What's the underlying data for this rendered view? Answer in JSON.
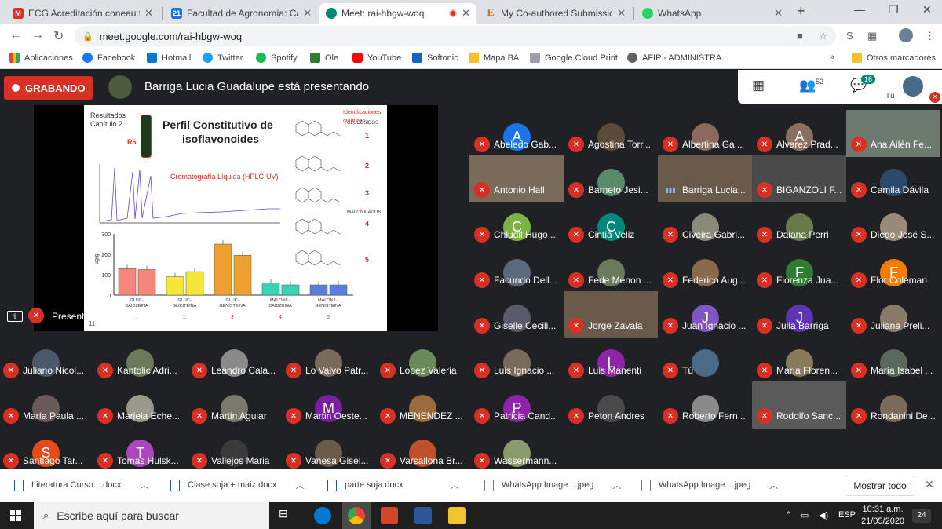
{
  "browser": {
    "tabs": [
      {
        "title": "ECG Acreditación coneau fich",
        "active": false,
        "fav_color": "#d93025"
      },
      {
        "title": "Facultad de Agronomía: Calen",
        "active": false,
        "fav_color": "#1a73e8"
      },
      {
        "title": "Meet: rai-hbgw-woq",
        "active": true,
        "fav_color": "#00897b"
      },
      {
        "title": "My Co-authored Submission",
        "active": false,
        "fav_color": "#e8710a"
      },
      {
        "title": "WhatsApp",
        "active": false,
        "fav_color": "#25d366"
      }
    ],
    "new_tab_label": "+",
    "url": "meet.google.com/rai-hbgw-woq",
    "bookmarks": [
      {
        "label": "Aplicaciones",
        "color": "#ea4335"
      },
      {
        "label": "Facebook",
        "color": "#1877f2"
      },
      {
        "label": "Hotmail",
        "color": "#0078d4"
      },
      {
        "label": "Twitter",
        "color": "#1da1f2"
      },
      {
        "label": "Spotify",
        "color": "#1db954"
      },
      {
        "label": "Ole",
        "color": "#2e7d32"
      },
      {
        "label": "YouTube",
        "color": "#ff0000"
      },
      {
        "label": "Softonic",
        "color": "#1565c0"
      },
      {
        "label": "Mapa BA",
        "color": "#fbc02d"
      },
      {
        "label": "Google Cloud Print",
        "color": "#5f6368"
      },
      {
        "label": "AFIP - ADMINISTRA...",
        "color": "#5f6368"
      }
    ],
    "other_bookmarks_label": "Otros marcadores"
  },
  "meet": {
    "recording_label": "GRABANDO",
    "presenting_text": "Barriga Lucia Guadalupe está presentando",
    "participants_count": "52",
    "chat_count": "16",
    "self_label": "Tú",
    "presentation_label": "Presentación (Barriga Lucia Guadalupe)",
    "slide": {
      "section_line1": "Resultados",
      "section_line2": "Capítulo 2",
      "stage": "R6",
      "title_line1": "Perfil Constitutivo de",
      "title_line2": "isoflavonoides",
      "chromatography": "Cromatografía Líquida (HPLC-UV)",
      "identifications": "Identificaciones químicas",
      "glucosides": "GLUCOSIDOS",
      "malonylated": "MALONILADOS",
      "compound_numbers": [
        "1",
        "2",
        "3",
        "4",
        "5"
      ],
      "y_axis_label": "µg/g",
      "y_ticks": [
        "300",
        "200",
        "100",
        "0"
      ],
      "page_number": "11"
    },
    "chart_data": {
      "type": "bar",
      "categories": [
        "GLUC-DAIDZEINA",
        "GLUC-GLICITEINA",
        "GLUC-GENISTEINA",
        "MALONIL-DAIDZEINA",
        "MALONIL-GENISTEINA"
      ],
      "category_numbers": [
        "1",
        "2",
        "3",
        "4",
        "5"
      ],
      "ylabel": "µg/g",
      "ylim": [
        0,
        300
      ],
      "series": [
        {
          "color": "#f4877a",
          "values": [
            130,
            90,
            250,
            60,
            50
          ]
        },
        {
          "color_list": [
            "#f4877a",
            "#f7e63a",
            "#f0a030",
            "#3ad2b0",
            "#5a7ee0"
          ],
          "values": [
            125,
            115,
            195,
            50,
            50
          ]
        }
      ]
    },
    "participants": [
      {
        "name": "Abeledo Gab...",
        "initial": "A",
        "color": "#1a73e8"
      },
      {
        "name": "Agostina Torr...",
        "initial": "",
        "color": "#5a4a3a"
      },
      {
        "name": "Albertina Ga...",
        "initial": "",
        "color": "#8a6a5a"
      },
      {
        "name": "Alvarez Prad...",
        "initial": "A",
        "color": "#8d6e63"
      },
      {
        "name": "Ana Ailén Fe...",
        "initial": "",
        "color": "#6d7a70",
        "video": true
      },
      {
        "name": "Antonio Hall",
        "initial": "",
        "color": "#7a6a5a",
        "video": true
      },
      {
        "name": "Barneto Jesi...",
        "initial": "",
        "color": "#5a8a6a"
      },
      {
        "name": "Barriga Lucia...",
        "initial": "",
        "color": "#6a5a4a",
        "video": true,
        "speaking": true
      },
      {
        "name": "BIGANZOLI F...",
        "initial": "",
        "color": "#4a4a4a",
        "video": true
      },
      {
        "name": "Camila Dávila",
        "initial": "",
        "color": "#2a4a6a"
      },
      {
        "name": "Chludil Hugo ...",
        "initial": "C",
        "color": "#7cb342"
      },
      {
        "name": "Cintia Veliz",
        "initial": "C",
        "color": "#00897b"
      },
      {
        "name": "Civeira Gabri...",
        "initial": "",
        "color": "#8a8a7a"
      },
      {
        "name": "Daiana Perri",
        "initial": "",
        "color": "#6a7a4a"
      },
      {
        "name": "Diego José S...",
        "initial": "",
        "color": "#9a8a7a"
      },
      {
        "name": "Facundo Dell...",
        "initial": "",
        "color": "#5a6a7a"
      },
      {
        "name": "Fede Menon ...",
        "initial": "",
        "color": "#6a7a5a"
      },
      {
        "name": "Federico Aug...",
        "initial": "",
        "color": "#8a6a4a"
      },
      {
        "name": "Fiorenza Jua...",
        "initial": "F",
        "color": "#2e7d32"
      },
      {
        "name": "Flor Coleman",
        "initial": "F",
        "color": "#f57c00"
      },
      {
        "name": "Giselle Cecili...",
        "initial": "",
        "color": "#5a5a6a"
      },
      {
        "name": "Jorge Zavala",
        "initial": "",
        "color": "#6a5a4a",
        "video": true
      },
      {
        "name": "Juan Ignacio ...",
        "initial": "J",
        "color": "#7e57c2"
      },
      {
        "name": "Julia Barriga",
        "initial": "J",
        "color": "#5e35b1"
      },
      {
        "name": "Juliana Preli...",
        "initial": "",
        "color": "#8a7a6a"
      },
      {
        "name": "Juliano Nicol...",
        "initial": "",
        "color": "#4a5a6a"
      },
      {
        "name": "Kantolic Adri...",
        "initial": "",
        "color": "#6a7a5a"
      },
      {
        "name": "Leandro Cala...",
        "initial": "",
        "color": "#8a8a8a"
      },
      {
        "name": "Lo Valvo Patr...",
        "initial": "",
        "color": "#7a6a5a"
      },
      {
        "name": "Lopez Valeria",
        "initial": "",
        "color": "#6a8a5a"
      },
      {
        "name": "Luis Ignacio ...",
        "initial": "",
        "color": "#7a6a5a"
      },
      {
        "name": "Luis Manenti",
        "initial": "L",
        "color": "#8e24aa"
      },
      {
        "name": "Tú",
        "initial": "",
        "color": "#4a6a8a"
      },
      {
        "name": "María Floren...",
        "initial": "",
        "color": "#8a7a5a"
      },
      {
        "name": "María Isabel ...",
        "initial": "",
        "color": "#5a6a5a"
      },
      {
        "name": "María Paula ...",
        "initial": "",
        "color": "#6a5a5a"
      },
      {
        "name": "Mariela Eche...",
        "initial": "",
        "color": "#9a9a8a"
      },
      {
        "name": "Martin Aguiar",
        "initial": "",
        "color": "#7a7a6a"
      },
      {
        "name": "Martin Oeste...",
        "initial": "M",
        "color": "#7b1fa2"
      },
      {
        "name": "MENENDEZ ...",
        "initial": "",
        "color": "#9a6a3a"
      },
      {
        "name": "Patricia Cand...",
        "initial": "P",
        "color": "#8e24aa"
      },
      {
        "name": "Peton Andres",
        "initial": "",
        "color": "#4a4a4a"
      },
      {
        "name": "Roberto Fern...",
        "initial": "",
        "color": "#8a8a8a"
      },
      {
        "name": "Rodolfo Sanc...",
        "initial": "",
        "color": "#5a5a5a",
        "video": true
      },
      {
        "name": "Rondanini De...",
        "initial": "",
        "color": "#7a6a5a"
      },
      {
        "name": "Santiago Tar...",
        "initial": "S",
        "color": "#e64a19"
      },
      {
        "name": "Tomas Hulsk...",
        "initial": "T",
        "color": "#ab47bc"
      },
      {
        "name": "Vallejos Maria",
        "initial": "",
        "color": "#3a3a3a"
      },
      {
        "name": "Vanesa Gisel...",
        "initial": "",
        "color": "#6a5a4a"
      },
      {
        "name": "Varsallona Br...",
        "initial": "",
        "color": "#c0502a"
      },
      {
        "name": "Wassermann...",
        "initial": "",
        "color": "#8a9a6a"
      }
    ]
  },
  "downloads": {
    "items": [
      "Literatura Curso....docx",
      "Clase soja + maiz.docx",
      "parte soja.docx",
      "WhatsApp Image....jpeg",
      "WhatsApp Image....jpeg"
    ],
    "show_all_label": "Mostrar todo"
  },
  "taskbar": {
    "search_placeholder": "Escribe aquí para buscar",
    "language": "ESP",
    "time": "10:31 a.m.",
    "date": "21/05/2020",
    "notification_count": "24"
  }
}
